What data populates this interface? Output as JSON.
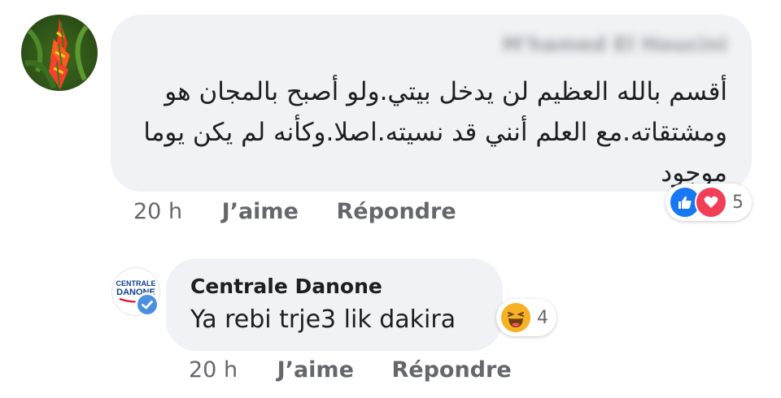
{
  "comment": {
    "author": "M'hamed El Houcini",
    "text": "أقسم بالله العظيم لن يدخل بيتي.ولو أصبح بالمجان هو ومشتقاته.مع العلم أنني قد نسيته.اصلا.وكأنه لم يكن يوما موجود",
    "time": "20 h",
    "like_label": "J’aime",
    "reply_label": "Répondre",
    "reactions": {
      "icons": [
        "like-icon",
        "love-icon"
      ],
      "count": "5"
    }
  },
  "reply": {
    "author": "Centrale Danone",
    "avatar_logo_line1": "CENTRALE",
    "avatar_logo_line2": "DANONE",
    "text": "Ya rebi trje3 lik dakira",
    "time": "20 h",
    "like_label": "J’aime",
    "reply_label": "Répondre",
    "reactions": {
      "icons": [
        "haha-icon"
      ],
      "count": "4"
    }
  },
  "colors": {
    "bubble": "#f0f2f5",
    "meta_text": "#65676b",
    "like_blue": "#1877f2",
    "love_red": "#f33e58",
    "haha_yellow": "#f7b125",
    "verified_blue": "#4a90e2"
  }
}
